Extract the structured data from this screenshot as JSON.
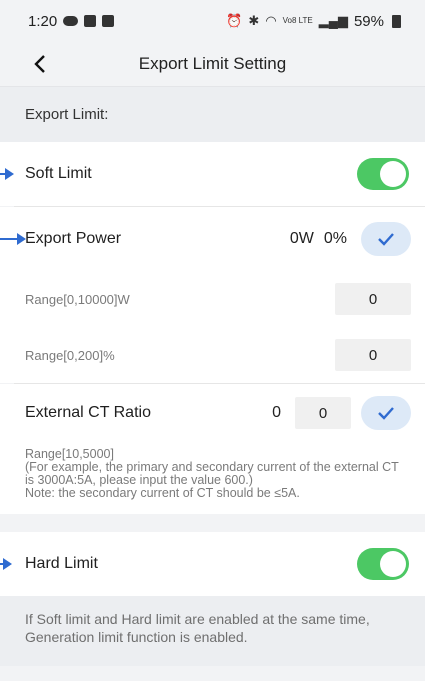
{
  "statusbar": {
    "time": "1:20",
    "battery": "59%",
    "network": "Vo8 LTE"
  },
  "header": {
    "title": "Export Limit Setting"
  },
  "section": {
    "title": "Export Limit:"
  },
  "soft_limit": {
    "label": "Soft Limit",
    "enabled": true
  },
  "export_power": {
    "label": "Export Power",
    "watts_display": "0W",
    "percent_display": "0%",
    "range_w_label": "Range[0,10000]W",
    "range_w_value": "0",
    "range_pct_label": "Range[0,200]%",
    "range_pct_value": "0"
  },
  "ct_ratio": {
    "label": "External CT Ratio",
    "current_value": "0",
    "input_value": "0",
    "note_line1": "Range[10,5000]",
    "note_line2": "(For example, the primary and secondary current of the external CT is 3000A:5A, please input the value 600.)",
    "note_line3": "Note: the secondary current of CT should be ≤5A."
  },
  "hard_limit": {
    "label": "Hard Limit",
    "enabled": true
  },
  "footer": {
    "note": "If Soft limit and Hard limit are enabled at the same time, Generation limit function  is enabled."
  },
  "colors": {
    "toggle_on": "#4cc864",
    "accent_blue": "#2f6bd0",
    "check_bg": "#dde9f7"
  }
}
